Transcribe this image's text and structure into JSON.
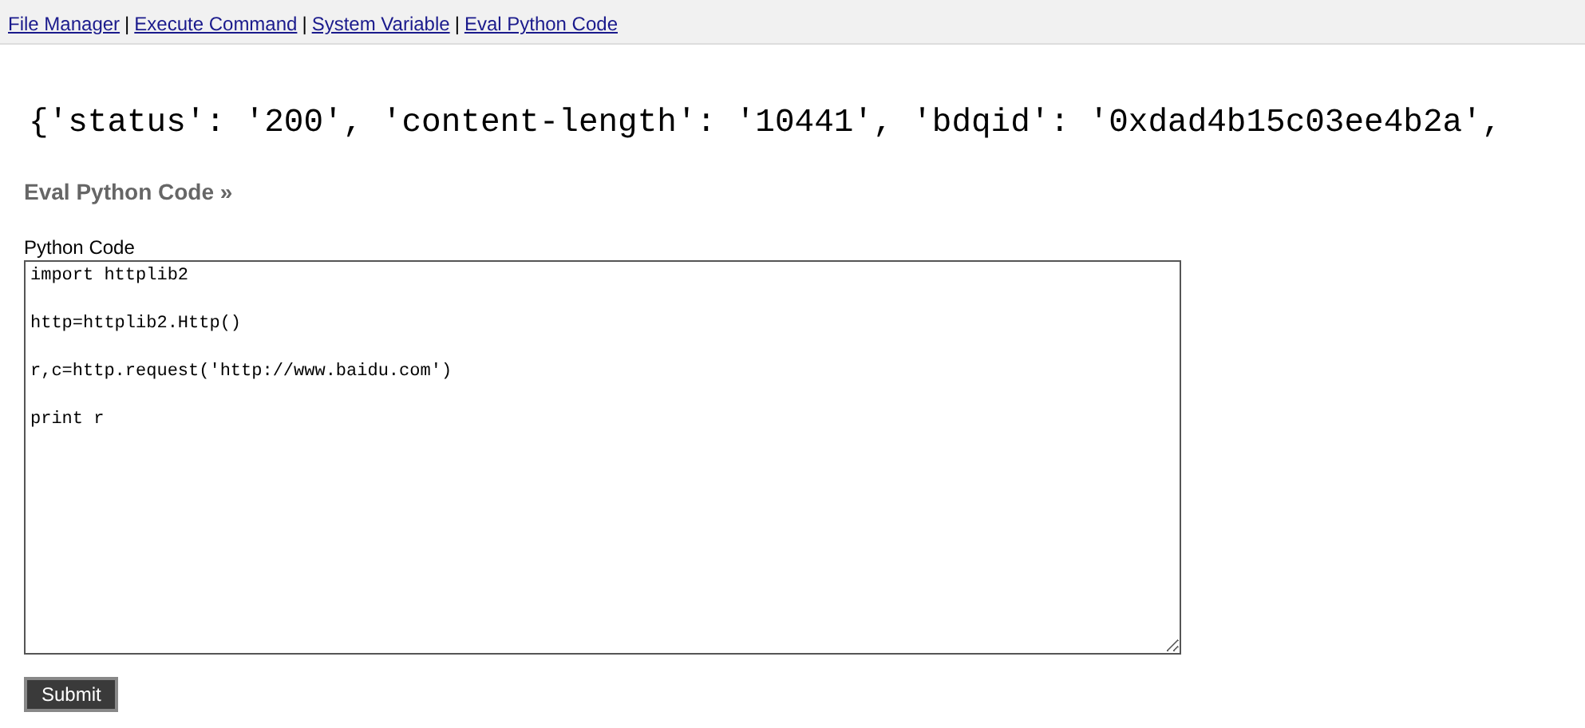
{
  "nav": {
    "links": [
      "File Manager",
      "Execute Command",
      "System Variable",
      "Eval Python Code"
    ],
    "separator": "|"
  },
  "output": "{'status': '200', 'content-length': '10441', 'bdqid': '0xdad4b15c03ee4b2a',",
  "section_title": "Eval Python Code »",
  "code_field": {
    "label": "Python Code",
    "value": "import httplib2\n\nhttp=httplib2.Http()\n\nr,c=http.request('http://www.baidu.com')\n\nprint r"
  },
  "submit": "Submit"
}
